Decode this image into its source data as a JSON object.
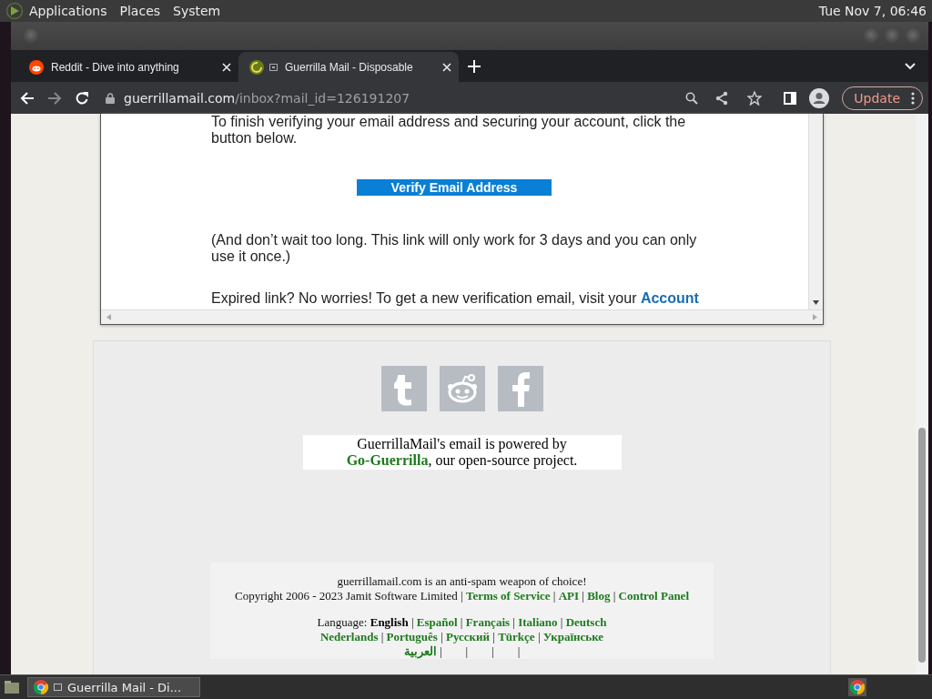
{
  "top_panel": {
    "menus": [
      "Applications",
      "Places",
      "System"
    ],
    "clock": "Tue Nov 7, 06:46"
  },
  "tabs": [
    {
      "title": "Reddit - Dive into anything",
      "selected": false,
      "kind": "reddit"
    },
    {
      "title": "Guerrilla Mail - Disposable",
      "selected": true,
      "kind": "guerrilla"
    }
  ],
  "address": {
    "host": "guerrillamail.com",
    "path": "/inbox?mail_id=126191207"
  },
  "update_button": "Update",
  "email": {
    "intro": "To finish verifying your email address and securing your account, click the button below.",
    "button": "Verify Email Address",
    "warning": "(And don’t wait too long. This link will only work for 3 days and you can only use it once.)",
    "expired": "Expired link? No worries! To get a new verification email, visit your",
    "expired_link": "Account"
  },
  "footer": {
    "social": [
      {
        "kind": "tumblr"
      },
      {
        "kind": "reddit"
      },
      {
        "kind": "facebook"
      }
    ],
    "powered": {
      "before": "GuerrillaMail's email is powered by",
      "link": "Go-Guerrilla",
      "after": ", our open-source project."
    },
    "tagline": "guerrillamail.com is an anti-spam weapon of choice!",
    "copyright": "Copyright 2006 - 2023 Jamit Software Limited",
    "separator": "|",
    "links": [
      "Terms of Service",
      "API",
      "Blog",
      "Control Panel"
    ],
    "language_label": "Language:",
    "language_rows": [
      [
        {
          "name": "English",
          "selected": true
        },
        {
          "name": "Español",
          "selected": false
        },
        {
          "name": "Français",
          "selected": false
        },
        {
          "name": "Italiano",
          "selected": false
        },
        {
          "name": "Deutsch",
          "selected": false
        }
      ],
      [
        {
          "name": "Nederlands",
          "selected": false
        },
        {
          "name": "Português",
          "selected": false
        },
        {
          "name": "Русский",
          "selected": false
        },
        {
          "name": "Türkçe",
          "selected": false
        },
        {
          "name": "Українське",
          "selected": false
        }
      ],
      [
        {
          "name": "العربية",
          "selected": false
        }
      ]
    ],
    "blank_separators": "|        |        |        |"
  },
  "taskbar": {
    "task": "Guerrilla Mail - Di..."
  }
}
